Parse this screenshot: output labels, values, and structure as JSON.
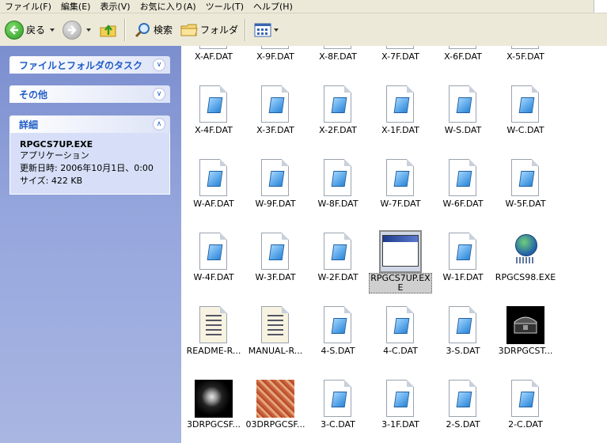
{
  "menu": [
    "ファイル(F)",
    "編集(E)",
    "表示(V)",
    "お気に入り(A)",
    "ツール(T)",
    "ヘルプ(H)"
  ],
  "toolbar": {
    "back_label": "戻る",
    "search_label": "検索",
    "folders_label": "フォルダ"
  },
  "taskpane": {
    "file_folder_tasks": "ファイルとフォルダのタスク",
    "other": "その他",
    "details": "詳細",
    "detail_name": "RPGCS7UP.EXE",
    "detail_type": "アプリケーション",
    "detail_date": "更新日時: 2006年10月1日、0:00",
    "detail_size": "サイズ: 422 KB"
  },
  "files": [
    {
      "name": "X-AF.DAT",
      "type": "dat"
    },
    {
      "name": "X-9F.DAT",
      "type": "dat"
    },
    {
      "name": "X-8F.DAT",
      "type": "dat"
    },
    {
      "name": "X-7F.DAT",
      "type": "dat"
    },
    {
      "name": "X-6F.DAT",
      "type": "dat"
    },
    {
      "name": "X-5F.DAT",
      "type": "dat"
    },
    {
      "name": "X-4F.DAT",
      "type": "dat"
    },
    {
      "name": "X-3F.DAT",
      "type": "dat"
    },
    {
      "name": "X-2F.DAT",
      "type": "dat"
    },
    {
      "name": "X-1F.DAT",
      "type": "dat"
    },
    {
      "name": "W-S.DAT",
      "type": "dat"
    },
    {
      "name": "W-C.DAT",
      "type": "dat"
    },
    {
      "name": "W-AF.DAT",
      "type": "dat"
    },
    {
      "name": "W-9F.DAT",
      "type": "dat"
    },
    {
      "name": "W-8F.DAT",
      "type": "dat"
    },
    {
      "name": "W-7F.DAT",
      "type": "dat"
    },
    {
      "name": "W-6F.DAT",
      "type": "dat"
    },
    {
      "name": "W-5F.DAT",
      "type": "dat"
    },
    {
      "name": "W-4F.DAT",
      "type": "dat"
    },
    {
      "name": "W-3F.DAT",
      "type": "dat"
    },
    {
      "name": "W-2F.DAT",
      "type": "dat"
    },
    {
      "name": "RPGCS7UP.EXE",
      "type": "exe",
      "selected": true
    },
    {
      "name": "W-1F.DAT",
      "type": "dat"
    },
    {
      "name": "RPGCS98.EXE",
      "type": "globe"
    },
    {
      "name": "README-R...",
      "type": "txt"
    },
    {
      "name": "MANUAL-R...",
      "type": "txt"
    },
    {
      "name": "4-S.DAT",
      "type": "dat"
    },
    {
      "name": "4-C.DAT",
      "type": "dat"
    },
    {
      "name": "3-S.DAT",
      "type": "dat"
    },
    {
      "name": "3DRPGCST...",
      "type": "chest"
    },
    {
      "name": "3DRPGCSF...",
      "type": "orb"
    },
    {
      "name": "03DRPGCSF...",
      "type": "texture"
    },
    {
      "name": "3-C.DAT",
      "type": "dat"
    },
    {
      "name": "3-1F.DAT",
      "type": "dat"
    },
    {
      "name": "2-S.DAT",
      "type": "dat"
    },
    {
      "name": "2-C.DAT",
      "type": "dat"
    }
  ]
}
